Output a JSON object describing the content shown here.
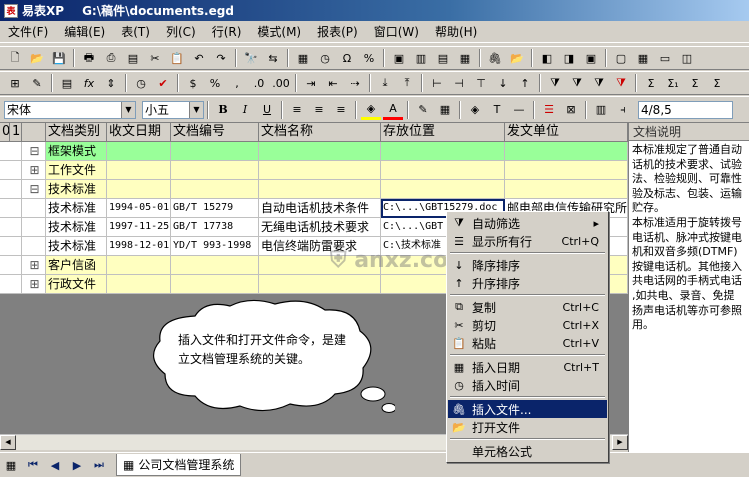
{
  "window": {
    "app": "易表XP",
    "file": "G:\\稿件\\documents.egd"
  },
  "menu": [
    "文件(F)",
    "编辑(E)",
    "表(T)",
    "列(C)",
    "行(R)",
    "模式(M)",
    "报表(P)",
    "窗口(W)",
    "帮助(H)"
  ],
  "format_bar": {
    "font": "宋体",
    "size": "小五",
    "cell_ref": "4/8,5"
  },
  "columns": [
    "文档类别",
    "收文日期",
    "文档编号",
    "文档名称",
    "存放位置",
    "发文单位"
  ],
  "level_headers": [
    "0",
    "1"
  ],
  "rows": [
    {
      "tree": "⊟",
      "cat": "框架模式",
      "date": "",
      "num": "",
      "name": "",
      "loc": "",
      "unit": ""
    },
    {
      "tree": "⊞",
      "cat": "工作文件",
      "date": "",
      "num": "",
      "name": "",
      "loc": "",
      "unit": ""
    },
    {
      "tree": "⊟",
      "cat": "技术标准",
      "date": "",
      "num": "",
      "name": "",
      "loc": "",
      "unit": ""
    },
    {
      "tree": "",
      "cat": "技术标准",
      "date": "1994-05-01",
      "num": "GB/T 15279",
      "name": "自动电话机技术条件",
      "loc": "C:\\...\\GBT15279.doc",
      "unit": "邮电部电信传输研究所"
    },
    {
      "tree": "",
      "cat": "技术标准",
      "date": "1997-11-25",
      "num": "GB/T 17738",
      "name": "无绳电话机技术要求",
      "loc": "C:\\...\\GBT",
      "unit": "究所"
    },
    {
      "tree": "",
      "cat": "技术标准",
      "date": "1998-12-01",
      "num": "YD/T 993-1998",
      "name": "电信终端防雷要求",
      "loc": "C:\\技术标准",
      "unit": "究所"
    },
    {
      "tree": "⊞",
      "cat": "客户信函",
      "date": "",
      "num": "",
      "name": "",
      "loc": "",
      "unit": ""
    },
    {
      "tree": "⊞",
      "cat": "行政文件",
      "date": "",
      "num": "",
      "name": "",
      "loc": "",
      "unit": ""
    }
  ],
  "notes": {
    "title": "文档说明",
    "text": "本标准规定了普通自动\n话机的技术要求、试验\n法、检验规则、可靠性\n验及标志、包装、运输\n贮存。\n本标准适用于旋转拨号\n电话机、脉冲式按键电\n机和双音多频(DTMF)\n按键电话机。其他接入\n共电话网的手柄式电话\n,如共电、录音、免提\n扬声电话机等亦可参照\n用。"
  },
  "context_menu": [
    {
      "label": "自动筛选",
      "shortcut": "▸",
      "icon": "filter-icon",
      "glyph": "⧩"
    },
    {
      "label": "显示所有行",
      "shortcut": "Ctrl+Q",
      "icon": "show-all-icon",
      "glyph": "☰"
    },
    {
      "label": "降序排序",
      "shortcut": "",
      "icon": "sort-desc-icon",
      "glyph": "↓"
    },
    {
      "label": "升序排序",
      "shortcut": "",
      "icon": "sort-asc-icon",
      "glyph": "↑"
    },
    {
      "label": "复制",
      "shortcut": "Ctrl+C",
      "icon": "copy-icon",
      "glyph": "⧉"
    },
    {
      "label": "剪切",
      "shortcut": "Ctrl+X",
      "icon": "cut-icon",
      "glyph": "✂"
    },
    {
      "label": "粘贴",
      "shortcut": "Ctrl+V",
      "icon": "paste-icon",
      "glyph": "📋"
    },
    {
      "label": "插入日期",
      "shortcut": "Ctrl+T",
      "icon": "calendar-icon",
      "glyph": "▦"
    },
    {
      "label": "插入时间",
      "shortcut": "",
      "icon": "clock-icon",
      "glyph": "◷"
    },
    {
      "label": "插入文件...",
      "shortcut": "",
      "icon": "paperclip-icon",
      "glyph": "🖇"
    },
    {
      "label": "打开文件",
      "shortcut": "",
      "icon": "open-file-icon",
      "glyph": "📂"
    },
    {
      "label": "单元格公式",
      "shortcut": "",
      "icon": "",
      "glyph": ""
    }
  ],
  "callout": "插入文件和打开文件命令，是建立文档管理系统的关键。",
  "sheet_tab": "公司文档管理系统",
  "watermark": "anxz.com",
  "colors": {
    "group_green": "#99ff99",
    "title_blue": "#0a246a",
    "highlight": "#0a246a",
    "row_yellow": "#ffffc0"
  }
}
